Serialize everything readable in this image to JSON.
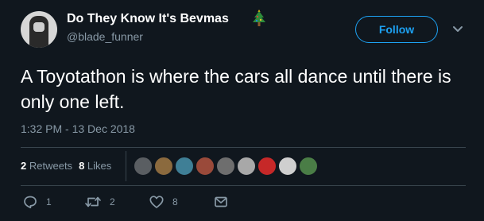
{
  "user": {
    "display_name": "Do They Know It's Bevmas",
    "handle": "@blade_funner",
    "name_emoji": "christmas-tree-icon"
  },
  "follow_button": {
    "label": "Follow"
  },
  "tweet": {
    "text": "A Toyotathon is where the cars all dance until there is only one left.",
    "timestamp": "1:32 PM - 13 Dec 2018"
  },
  "stats": {
    "retweets_count": "2",
    "retweets_label": "Retweets",
    "likes_count": "8",
    "likes_label": "Likes"
  },
  "likers": [
    {
      "name": "liker-avatar-1",
      "color": "#5a5e62"
    },
    {
      "name": "liker-avatar-2",
      "color": "#8b6a3e"
    },
    {
      "name": "liker-avatar-3",
      "color": "#3f7f96"
    },
    {
      "name": "liker-avatar-4",
      "color": "#9a4a3a"
    },
    {
      "name": "liker-avatar-5",
      "color": "#6e6e6e"
    },
    {
      "name": "liker-avatar-6",
      "color": "#a8a8a8"
    },
    {
      "name": "liker-avatar-7",
      "color": "#c62828"
    },
    {
      "name": "liker-avatar-8",
      "color": "#cfcfcf"
    },
    {
      "name": "liker-avatar-9",
      "color": "#4a7d46"
    }
  ],
  "actions": {
    "reply_count": "1",
    "retweet_count": "2",
    "like_count": "8",
    "icons": [
      "reply-icon",
      "retweet-icon",
      "like-icon",
      "direct-message-icon"
    ]
  },
  "colors": {
    "background": "#10171e",
    "accent": "#1da1f2",
    "secondary_text": "#8899a6",
    "divider": "#38444d"
  }
}
